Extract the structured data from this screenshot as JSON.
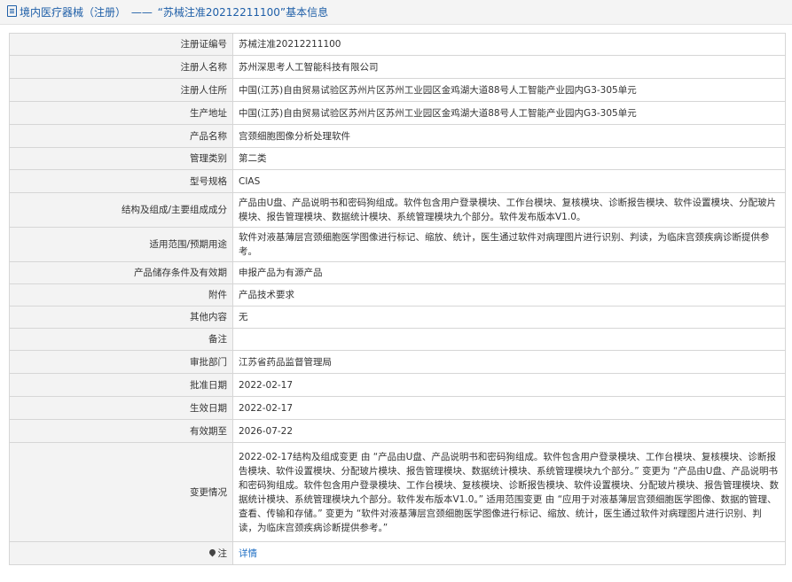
{
  "header": {
    "category": "境内医疗器械（注册）",
    "separator": "——",
    "title": "“苏械注准20212211100”基本信息"
  },
  "rows": [
    {
      "label": "注册证编号",
      "value": "苏械注准20212211100"
    },
    {
      "label": "注册人名称",
      "value": "苏州深思考人工智能科技有限公司"
    },
    {
      "label": "注册人住所",
      "value": "中国(江苏)自由贸易试验区苏州片区苏州工业园区金鸡湖大道88号人工智能产业园内G3-305单元"
    },
    {
      "label": "生产地址",
      "value": "中国(江苏)自由贸易试验区苏州片区苏州工业园区金鸡湖大道88号人工智能产业园内G3-305单元"
    },
    {
      "label": "产品名称",
      "value": "宫颈细胞图像分析处理软件"
    },
    {
      "label": "管理类别",
      "value": "第二类"
    },
    {
      "label": "型号规格",
      "value": "CIAS"
    },
    {
      "label": "结构及组成/主要组成成分",
      "value": "产品由U盘、产品说明书和密码狗组成。软件包含用户登录模块、工作台模块、复核模块、诊断报告模块、软件设置模块、分配玻片模块、报告管理模块、数据统计模块、系统管理模块九个部分。软件发布版本V1.0。"
    },
    {
      "label": "适用范围/预期用途",
      "value": "软件对液基薄层宫颈细胞医学图像进行标记、缩放、统计，医生通过软件对病理图片进行识别、判读，为临床宫颈疾病诊断提供参考。"
    },
    {
      "label": "产品储存条件及有效期",
      "value": "申报产品为有源产品"
    },
    {
      "label": "附件",
      "value": "产品技术要求"
    },
    {
      "label": "其他内容",
      "value": "无"
    },
    {
      "label": "备注",
      "value": ""
    },
    {
      "label": "审批部门",
      "value": "江苏省药品监督管理局"
    },
    {
      "label": "批准日期",
      "value": "2022-02-17"
    },
    {
      "label": "生效日期",
      "value": "2022-02-17"
    },
    {
      "label": "有效期至",
      "value": "2026-07-22"
    },
    {
      "label": "变更情况",
      "value": "2022-02-17结构及组成变更 由 “产品由U盘、产品说明书和密码狗组成。软件包含用户登录模块、工作台模块、复核模块、诊断报告模块、软件设置模块、分配玻片模块、报告管理模块、数据统计模块、系统管理模块九个部分。” 变更为 “产品由U盘、产品说明书和密码狗组成。软件包含用户登录模块、工作台模块、复核模块、诊断报告模块、软件设置模块、分配玻片模块、报告管理模块、数据统计模块、系统管理模块九个部分。软件发布版本V1.0。” 适用范围变更 由 “应用于对液基薄层宫颈细胞医学图像、数据的管理、查看、传输和存储。” 变更为 “软件对液基薄层宫颈细胞医学图像进行标记、缩放、统计，医生通过软件对病理图片进行识别、判读，为临床宫颈疾病诊断提供参考。”"
    }
  ],
  "note": {
    "label": "注",
    "link_text": "详情",
    "icon": "pin-icon"
  }
}
